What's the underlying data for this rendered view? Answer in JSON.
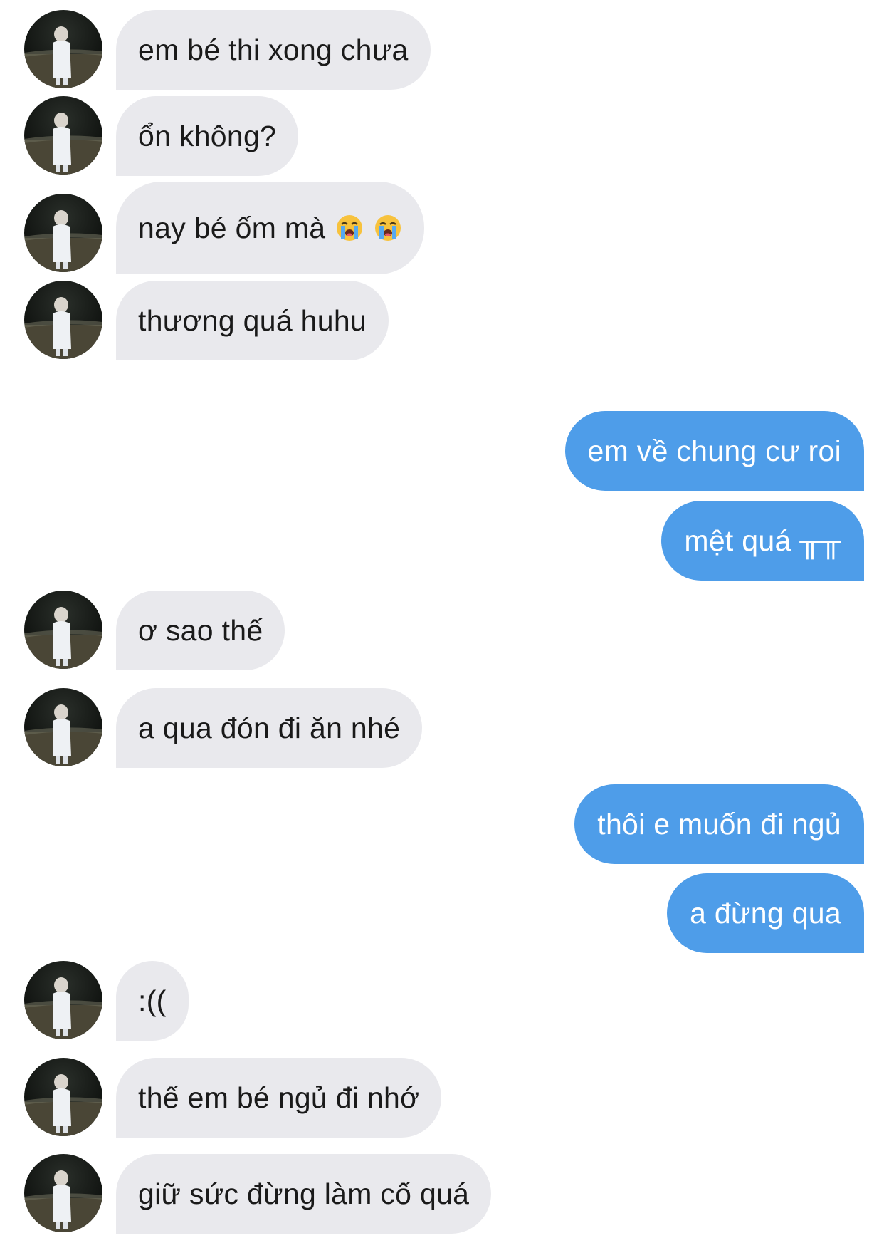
{
  "messages": [
    {
      "side": "in",
      "text": "em bé thi xong chưa"
    },
    {
      "side": "in",
      "text": "ổn không?"
    },
    {
      "side": "in",
      "text": "nay bé ốm mà",
      "emoji": [
        "loudly-crying-face-icon",
        "loudly-crying-face-icon"
      ]
    },
    {
      "side": "in",
      "text": "thương quá huhu"
    },
    {
      "side": "out",
      "text": "em về chung cư roi"
    },
    {
      "side": "out",
      "text": "mệt quá ╥╥"
    },
    {
      "side": "in",
      "text": "ơ sao thế"
    },
    {
      "side": "in",
      "text": "a qua đón đi ăn nhé"
    },
    {
      "side": "out",
      "text": "thôi e muốn đi ngủ"
    },
    {
      "side": "out",
      "text": "a đừng qua"
    },
    {
      "side": "in",
      "text": ":(("
    },
    {
      "side": "in",
      "text": "thế em bé ngủ đi nhớ"
    },
    {
      "side": "in",
      "text": "giữ sức đừng làm cố quá"
    }
  ],
  "colors": {
    "incoming_bubble": "#e9e9ed",
    "outgoing_bubble": "#4e9de9",
    "incoming_text": "#1a1a1a",
    "outgoing_text": "#ffffff"
  }
}
